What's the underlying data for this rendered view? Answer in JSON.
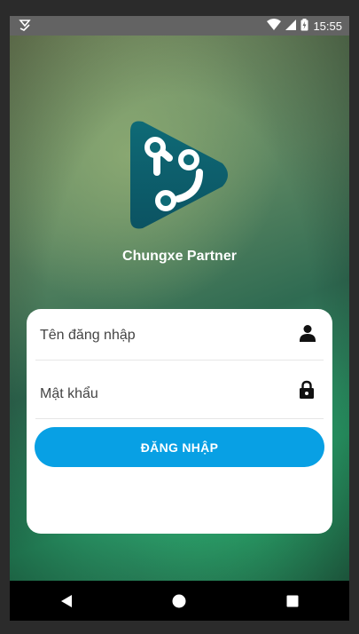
{
  "status_bar": {
    "time": "15:55"
  },
  "icons": {
    "notification": "download-done-icon",
    "wifi": "wifi-icon",
    "signal": "signal-icon",
    "battery": "battery-charging-icon",
    "user": "person-icon",
    "password": "lock-icon"
  },
  "app": {
    "name": "Chungxe Partner"
  },
  "login_form": {
    "username_placeholder": "Tên đăng nhập",
    "password_placeholder": "Mật khẩu",
    "submit_label": "ĐĂNG NHẬP"
  },
  "colors": {
    "accent": "#08a0e4",
    "logo_primary": "#0e5f6d",
    "status_bar": "#636363",
    "nav_bar": "#000000"
  }
}
